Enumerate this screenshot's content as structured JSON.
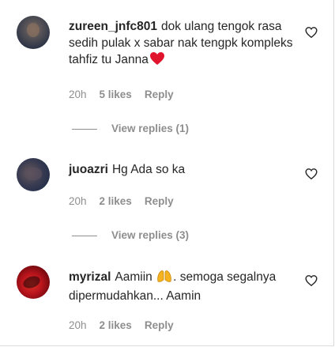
{
  "comments": [
    {
      "username": "zureen_jnfc801",
      "text": "dok ulang tengok rasa sedih pulak x sabar nak tengpk kompleks tahfiz tu Janna",
      "time": "20h",
      "likes": "5 likes",
      "reply": "Reply",
      "view_replies": "View replies (1)"
    },
    {
      "username": "juoazri",
      "text": "Hg Ada so ka",
      "time": "20h",
      "likes": "2 likes",
      "reply": "Reply",
      "view_replies": "View replies (3)"
    },
    {
      "username": "myrizal",
      "text_before": "Aamiin",
      "text_after": ". semoga segalnya dipermudahkan... Aamin",
      "time": "20h",
      "likes": "2 likes",
      "reply": "Reply"
    }
  ],
  "colors": {
    "heart_emoji": "#e0142c",
    "hands_emoji": "#f5b21e",
    "muted": "#8e8e8e"
  },
  "icons": {
    "like": "heart-outline-icon"
  }
}
